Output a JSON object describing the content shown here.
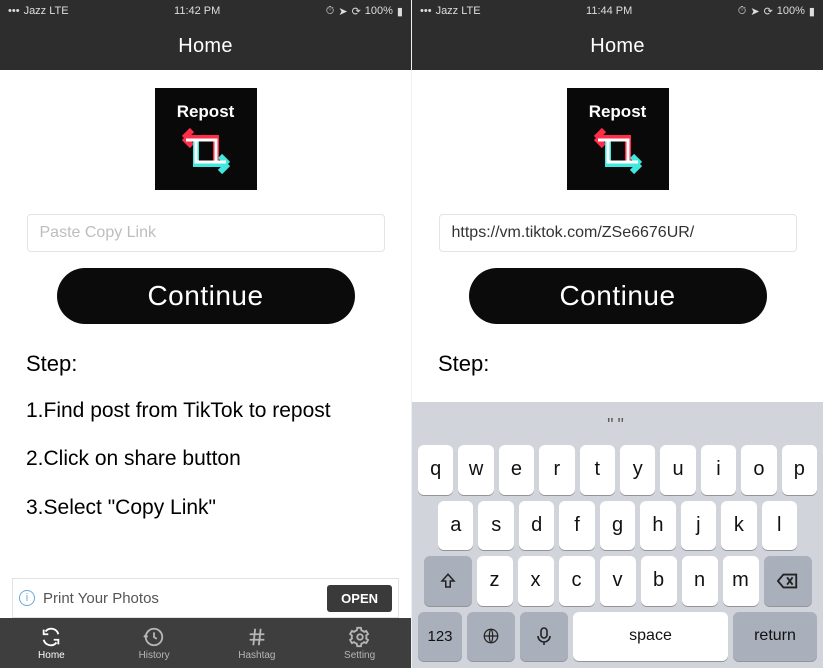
{
  "left": {
    "status": {
      "carrier": "Jazz  LTE",
      "time": "11:42 PM",
      "battery": "100%"
    },
    "navTitle": "Home",
    "logoText": "Repost",
    "inputPlaceholder": "Paste Copy Link",
    "inputValue": "",
    "continueLabel": "Continue",
    "stepsHeading": "Step:",
    "steps": [
      "1.Find post from TikTok to repost",
      "2.Click on share button",
      "3.Select \"Copy Link\""
    ],
    "ad": {
      "text": "Print Your Photos",
      "cta": "OPEN"
    },
    "tabs": [
      {
        "label": "Home",
        "active": true
      },
      {
        "label": "History",
        "active": false
      },
      {
        "label": "Hashtag",
        "active": false
      },
      {
        "label": "Setting",
        "active": false
      }
    ]
  },
  "right": {
    "status": {
      "carrier": "Jazz  LTE",
      "time": "11:44 PM",
      "battery": "100%"
    },
    "navTitle": "Home",
    "logoText": "Repost",
    "inputPlaceholder": "Paste Copy Link",
    "inputValue": "https://vm.tiktok.com/ZSe6676UR/",
    "continueLabel": "Continue",
    "stepsHeading": "Step:",
    "keyboard": {
      "prediction": "\"\"",
      "row1": [
        "q",
        "w",
        "e",
        "r",
        "t",
        "y",
        "u",
        "i",
        "o",
        "p"
      ],
      "row2": [
        "a",
        "s",
        "d",
        "f",
        "g",
        "h",
        "j",
        "k",
        "l"
      ],
      "row3": [
        "z",
        "x",
        "c",
        "v",
        "b",
        "n",
        "m"
      ],
      "numKey": "123",
      "spaceKey": "space",
      "returnKey": "return"
    }
  }
}
